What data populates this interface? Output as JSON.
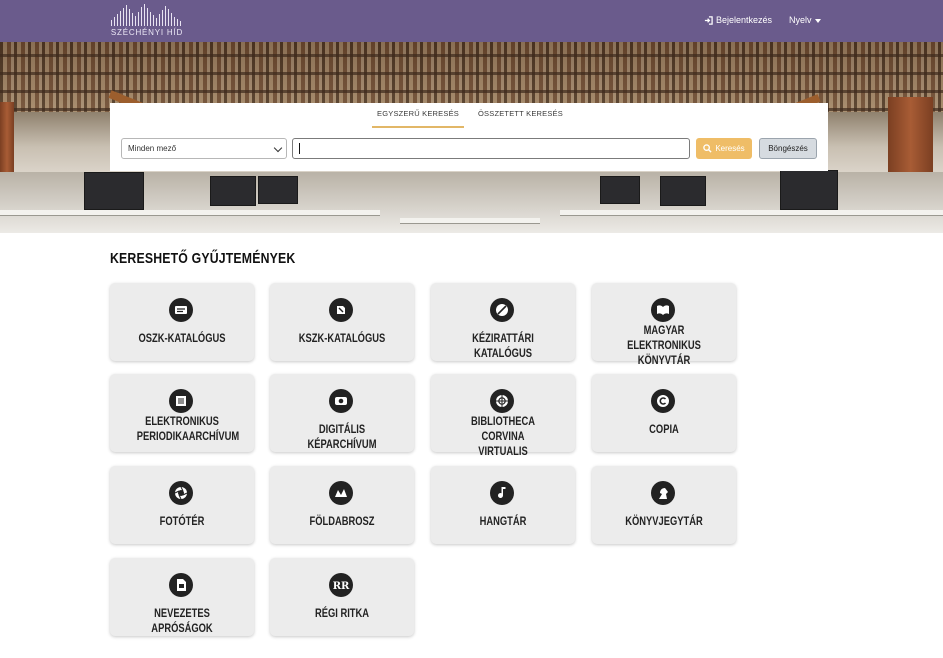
{
  "header": {
    "logo_text": "SZÉCHÉNYI HÍD",
    "login_label": "Bejelentkezés",
    "language_label": "Nyelv",
    "background_color": "#6a5b8c"
  },
  "search": {
    "tabs": [
      "EGYSZERŰ KERESÉS",
      "ÖSSZETETT KERESÉS"
    ],
    "active_tab": "EGYSZERŰ KERESÉS",
    "field_select_value": "Minden mező",
    "query_value": "",
    "search_button_label": "Keresés",
    "browse_button_label": "Böngészés",
    "accent_color": "#efbd67"
  },
  "collections": {
    "title": "KERESHETŐ GYŰJTEMÉNYEK",
    "items": [
      {
        "label": "OSZK-KATALÓGUS",
        "icon": "catalog-icon"
      },
      {
        "label": "KSZK-KATALÓGUS",
        "icon": "kszk-icon"
      },
      {
        "label": "KÉZIRATTÁRI KATALÓGUS",
        "icon": "manuscript-icon"
      },
      {
        "label": "MAGYAR ELEKTRONIKUS KÖNYVTÁR",
        "icon": "book-icon"
      },
      {
        "label": "ELEKTRONIKUS PERIODIKAARCHÍVUM",
        "icon": "periodical-icon"
      },
      {
        "label": "DIGITÁLIS KÉPARCHÍVUM",
        "icon": "image-archive-icon"
      },
      {
        "label": "BIBLIOTHECA CORVINA VIRTUALIS",
        "icon": "corvina-icon"
      },
      {
        "label": "COPIA",
        "icon": "copyright-icon"
      },
      {
        "label": "FOTÓTÉR",
        "icon": "camera-aperture-icon"
      },
      {
        "label": "FÖLDABROSZ",
        "icon": "map-icon"
      },
      {
        "label": "HANGTÁR",
        "icon": "music-note-icon"
      },
      {
        "label": "KÖNYVJEGYTÁR",
        "icon": "knight-icon"
      },
      {
        "label": "NEVEZETES APRÓSÁGOK",
        "icon": "document-icon"
      },
      {
        "label": "RÉGI RITKA",
        "icon": "rr-icon"
      }
    ]
  }
}
